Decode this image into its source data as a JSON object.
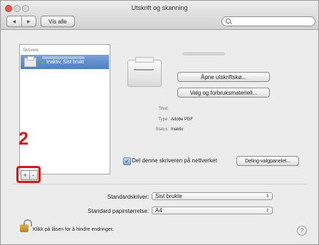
{
  "window": {
    "title": "Utskrift og skanning"
  },
  "toolbar": {
    "back": "◀",
    "forward": "▶",
    "show_all": "Vis alle",
    "search_placeholder": ""
  },
  "printers": {
    "header": "Skrivere",
    "items": [
      {
        "status": "Inaktiv, Sist brukt"
      }
    ],
    "add": "+",
    "remove": "-"
  },
  "annotation": {
    "step": "2"
  },
  "detail": {
    "open_queue": "Åpne utskriftskø...",
    "supplies": "Valg og forbruksmateriell...",
    "location_label": "Sted:",
    "type_label": "Type:",
    "type_value": "Adobe PDF",
    "status_label": "Status:",
    "status_value": "Inaktiv",
    "share_checked": true,
    "share_label": "Del denne skriveren på nettverket",
    "share_prefs": "Deling-valgpanelet..."
  },
  "defaults": {
    "printer_label": "Standardskriver:",
    "printer_value": "Sist brukte",
    "paper_label": "Standard papirstørrelse:",
    "paper_value": "A4"
  },
  "footer": {
    "lock_text": "Klikk på låsen for å hindre endringer.",
    "help": "?"
  },
  "colors": {
    "selection": "#4f7fc4",
    "annotation": "#d4171c"
  }
}
